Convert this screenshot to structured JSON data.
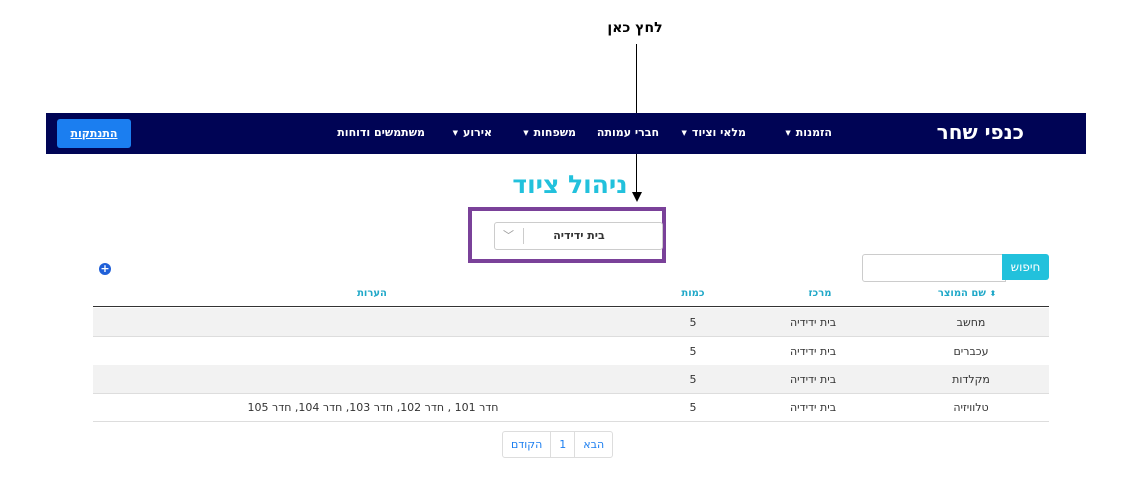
{
  "annotation": {
    "text": "לחץ כאן"
  },
  "navbar": {
    "brand": "כנפי שחר",
    "items": [
      {
        "label": "הזמנות",
        "dropdown": true
      },
      {
        "label": "מלאי וציוד",
        "dropdown": true
      },
      {
        "label": "חברי עמותה",
        "dropdown": false
      },
      {
        "label": "משפחות",
        "dropdown": true
      },
      {
        "label": "אירוע",
        "dropdown": true
      },
      {
        "label": "משתמשים ודוחות",
        "dropdown": false
      }
    ],
    "logout": "התנתקות"
  },
  "page": {
    "title": "ניהול ציוד"
  },
  "center_select": {
    "value": "בית ידידיה"
  },
  "search": {
    "button": "חיפוש",
    "value": ""
  },
  "table": {
    "headers": {
      "product": "שם המוצר",
      "center": "מרכז",
      "quantity": "כמות",
      "notes": "הערות"
    },
    "rows": [
      {
        "product": "מחשב",
        "center": "בית ידידיה",
        "quantity": "5",
        "notes": ""
      },
      {
        "product": "עכברים",
        "center": "בית ידידיה",
        "quantity": "5",
        "notes": ""
      },
      {
        "product": "מקלדות",
        "center": "בית ידידיה",
        "quantity": "5",
        "notes": ""
      },
      {
        "product": "טלוויזיה",
        "center": "בית ידידיה",
        "quantity": "5",
        "notes": "חדר 101 , חדר 102, חדר 103, חדר 104, חדר 105"
      }
    ]
  },
  "pagination": {
    "prev": "הקודם",
    "page": "1",
    "next": "הבא"
  },
  "colors": {
    "navbar": "#000455",
    "accent": "#22c1dc",
    "logout": "#1b7ef0",
    "highlight": "#7a4199"
  }
}
